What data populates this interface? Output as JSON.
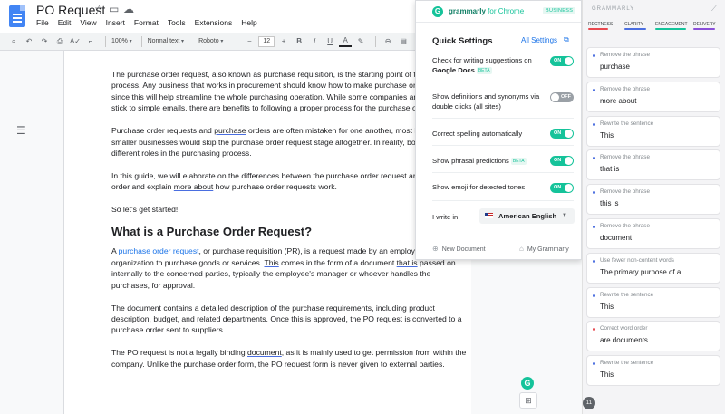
{
  "doc": {
    "title": "PO Request",
    "menu": [
      "File",
      "Edit",
      "View",
      "Insert",
      "Format",
      "Tools",
      "Extensions",
      "Help"
    ],
    "toolbar": {
      "zoom": "100%",
      "style": "Normal text",
      "font": "Roboto",
      "font_size": "12"
    },
    "paragraphs": {
      "p1": "The purchase order request, also known as purchase requisition, is the starting point of the purchasing process. Any business that works in procurement should know how to make purchase order requests since this will help streamline the whole purchasing operation. While some companies are happy to stick to simple emails, there are benefits to following a proper process for the purchase order request.",
      "p2a": "Purchase order requests and ",
      "p2u": "purchase",
      "p2b": " orders are often mistaken for one another, most likely because smaller businesses would skip the purchase order request stage altogether. In reality, both play different roles in the purchasing process.",
      "p3a": "In this guide, we will elaborate on the differences between the purchase order request and purchase order and explain ",
      "p3u": "more about",
      "p3b": " how purchase order requests work.",
      "p4": "So let's get started!",
      "h2": "What is a Purchase Order Request?",
      "p5a": "A ",
      "p5link": "purchase order request",
      "p5b": ", or purchase requisition (PR), is a request made by an employee within an organization to purchase goods or services. ",
      "p5u1": "This",
      "p5c": " comes in the form of a document ",
      "p5u2": "that is",
      "p5d": " passed on internally to the concerned parties, typically the employee's manager or whoever handles the purchases, for approval.",
      "p6a": "The document contains a detailed description of the purchase requirements, including product description, budget, and related departments. Once ",
      "p6u": "this is",
      "p6b": " approved, the PO request is converted to a purchase order sent to suppliers.",
      "p7a": "The PO request is not a legally binding ",
      "p7u": "document",
      "p7b": ", as it is mainly used to get permission from within the company. Unlike the purchase order form, the PO request form is never given to external parties."
    }
  },
  "popup": {
    "brand_name": "grammarly",
    "brand_suffix": "for Chrome",
    "badge": "BUSINESS",
    "title": "Quick Settings",
    "all_settings": "All Settings",
    "options": [
      {
        "label": "Check for writing suggestions on ",
        "bold": "Google Docs",
        "beta": "BETA",
        "state": "ON"
      },
      {
        "label": "Show definitions and synonyms via double clicks (all sites)",
        "state": "OFF"
      },
      {
        "label": "Correct spelling automatically",
        "state": "ON"
      },
      {
        "label": "Show phrasal predictions",
        "beta": "BETA",
        "state": "ON"
      },
      {
        "label": "Show emoji for detected tones",
        "state": "ON"
      }
    ],
    "write_in_label": "I write in",
    "language": "American English",
    "new_document": "New Document",
    "my_grammarly": "My Grammarly"
  },
  "sidebar": {
    "title": "GRAMMARLY",
    "tabs": [
      {
        "label": "RECTNESS",
        "color": "#e8484f"
      },
      {
        "label": "CLARITY",
        "color": "#4a6ee0"
      },
      {
        "label": "ENGAGEMENT",
        "color": "#15c39a"
      },
      {
        "label": "DELIVERY",
        "color": "#8a4fd8"
      }
    ],
    "cards": [
      {
        "action": "Remove the phrase",
        "text": "purchase",
        "color": "#4a6ee0"
      },
      {
        "action": "Remove the phrase",
        "text": "more about",
        "color": "#4a6ee0"
      },
      {
        "action": "Rewrite the sentence",
        "text": "This",
        "color": "#4a6ee0"
      },
      {
        "action": "Remove the phrase",
        "text": "that is",
        "color": "#4a6ee0"
      },
      {
        "action": "Remove the phrase",
        "text": "this is",
        "color": "#4a6ee0"
      },
      {
        "action": "Remove the phrase",
        "text": "document",
        "color": "#4a6ee0"
      },
      {
        "action": "Use fewer non-content words",
        "text": "The primary purpose of a ...",
        "color": "#4a6ee0"
      },
      {
        "action": "Rewrite the sentence",
        "text": "This",
        "color": "#4a6ee0"
      },
      {
        "action": "Correct word order",
        "text": "are documents",
        "color": "#e8484f"
      },
      {
        "action": "Rewrite the sentence",
        "text": "This",
        "color": "#4a6ee0"
      }
    ],
    "count": "11"
  }
}
